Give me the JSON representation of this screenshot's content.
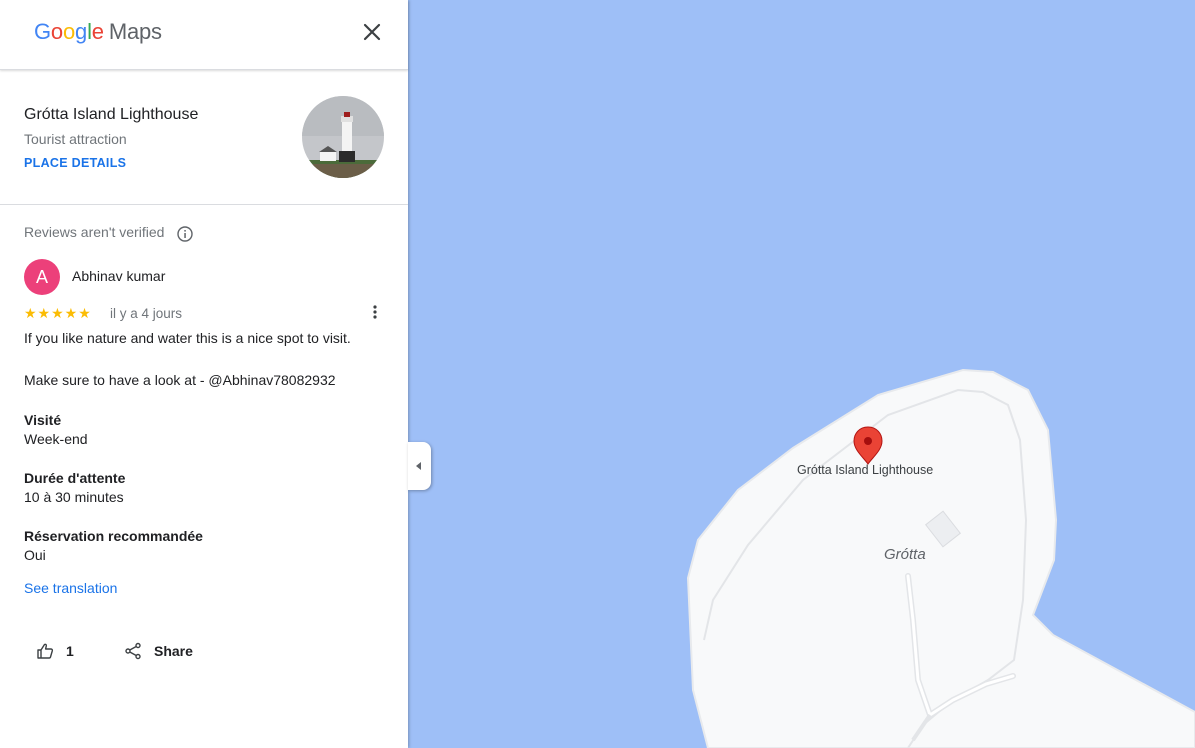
{
  "header": {
    "logo_letters": [
      "G",
      "o",
      "o",
      "g",
      "l",
      "e"
    ],
    "logo_product": "Maps"
  },
  "place": {
    "title": "Grótta Island Lighthouse",
    "type": "Tourist attraction",
    "details_link": "PLACE DETAILS"
  },
  "reviews": {
    "verify_note": "Reviews aren't verified",
    "review": {
      "avatar_initial": "A",
      "author": "Abhinav kumar",
      "rating": 5,
      "stars": "★★★★★",
      "date": "il y a 4 jours",
      "text_line1": "If you like nature and water this is a nice spot to visit.",
      "text_line2": "Make sure to have a look at - @Abhinav78082932",
      "visit_label": "Visité",
      "visit_value": "Week-end",
      "wait_label": "Durée d'attente",
      "wait_value": "10 à 30 minutes",
      "reservation_label": "Réservation recommandée",
      "reservation_value": "Oui",
      "translation_link": "See translation",
      "like_count": "1",
      "share_label": "Share"
    }
  },
  "map": {
    "pin_label": "Grótta Island Lighthouse",
    "island_label": "Grótta",
    "colors": {
      "water": "#9ebff7",
      "land": "#f8f9fa",
      "pin": "#ea4335",
      "accent": "#1a73e8",
      "avatar": "#ec407a",
      "stars": "#fbbc04"
    }
  }
}
